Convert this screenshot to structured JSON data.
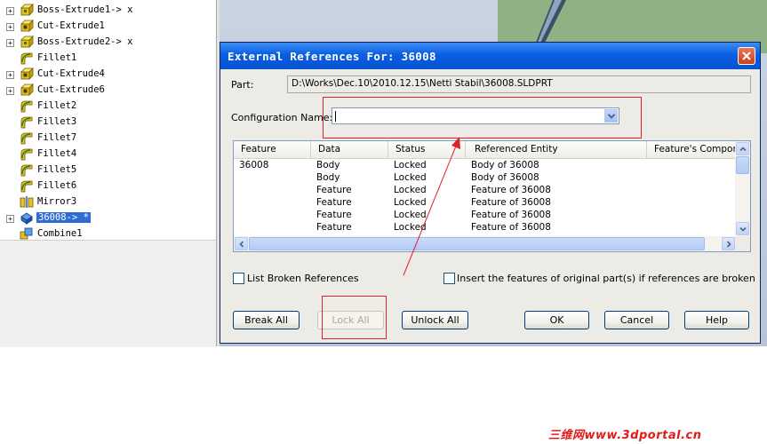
{
  "feature_tree": [
    {
      "label": "Boss-Extrude1-> x",
      "expand": "+",
      "icon": "extrude-icon",
      "selected": false
    },
    {
      "label": "Cut-Extrude1",
      "expand": "+",
      "icon": "cut-extrude-icon",
      "selected": false
    },
    {
      "label": "Boss-Extrude2-> x",
      "expand": "+",
      "icon": "extrude-icon",
      "selected": false
    },
    {
      "label": "Fillet1",
      "expand": "",
      "icon": "fillet-icon",
      "selected": false
    },
    {
      "label": "Cut-Extrude4",
      "expand": "+",
      "icon": "cut-extrude-icon",
      "selected": false
    },
    {
      "label": "Cut-Extrude6",
      "expand": "+",
      "icon": "cut-extrude-icon",
      "selected": false
    },
    {
      "label": "Fillet2",
      "expand": "",
      "icon": "fillet-icon",
      "selected": false
    },
    {
      "label": "Fillet3",
      "expand": "",
      "icon": "fillet-icon",
      "selected": false
    },
    {
      "label": "Fillet7",
      "expand": "",
      "icon": "fillet-icon",
      "selected": false
    },
    {
      "label": "Fillet4",
      "expand": "",
      "icon": "fillet-icon",
      "selected": false
    },
    {
      "label": "Fillet5",
      "expand": "",
      "icon": "fillet-icon",
      "selected": false
    },
    {
      "label": "Fillet6",
      "expand": "",
      "icon": "fillet-icon",
      "selected": false
    },
    {
      "label": "Mirror3",
      "expand": "",
      "icon": "mirror-icon",
      "selected": false
    },
    {
      "label": "36008-> *",
      "expand": "+",
      "icon": "external-part-icon",
      "selected": true
    },
    {
      "label": "Combine1",
      "expand": "",
      "icon": "combine-icon",
      "selected": false
    }
  ],
  "dialog": {
    "title": "External References For: 36008",
    "close_icon": "close-icon",
    "part_label": "Part:",
    "part_path": "D:\\Works\\Dec.10\\2010.12.15\\Netti Stabil\\36008.SLDPRT",
    "config_label": "Configuration Name:",
    "config_value": "",
    "columns": [
      "Feature",
      "Data",
      "Status",
      "Referenced Entity",
      "Feature's Compon..."
    ],
    "rows": [
      [
        "36008",
        "Body",
        "Locked",
        "Body of 36008"
      ],
      [
        "",
        "Body",
        "Locked",
        "Body of 36008"
      ],
      [
        "",
        "Feature",
        "Locked",
        "Feature of 36008"
      ],
      [
        "",
        "Feature",
        "Locked",
        "Feature of 36008"
      ],
      [
        "",
        "Feature",
        "Locked",
        "Feature of 36008"
      ],
      [
        "",
        "Feature",
        "Locked",
        "Feature of 36008"
      ]
    ],
    "list_broken_label": "List Broken References",
    "list_broken_checked": false,
    "insert_features_label": "Insert the features of original part(s) if references are broken",
    "insert_features_checked": false,
    "buttons": {
      "break_all": "Break All",
      "lock_all": "Lock All",
      "unlock_all": "Unlock All",
      "ok": "OK",
      "cancel": "Cancel",
      "help": "Help"
    }
  },
  "watermark": "三维网www.3dportal.cn",
  "colors": {
    "title_bar": "#0553d1",
    "selection": "#2e6bd6",
    "annotation": "#e0202a",
    "watermark": "#e11b1b"
  }
}
